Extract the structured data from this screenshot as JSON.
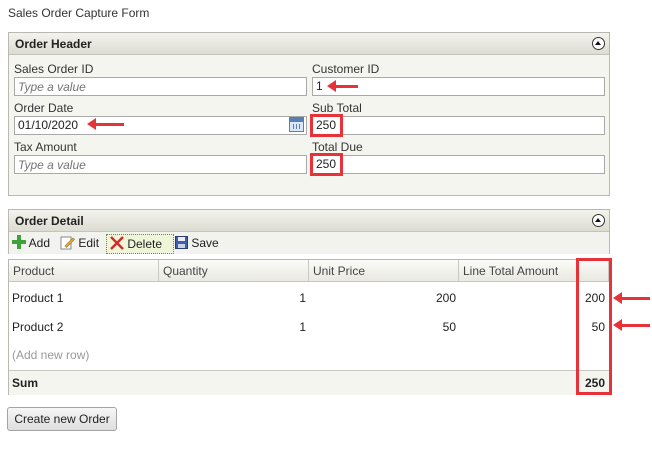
{
  "form_title": "Sales Order Capture Form",
  "order_header": {
    "title": "Order Header",
    "sales_order_id": {
      "label": "Sales Order ID",
      "placeholder": "Type a value"
    },
    "customer_id": {
      "label": "Customer ID",
      "value": "1"
    },
    "order_date": {
      "label": "Order Date",
      "value": "01/10/2020"
    },
    "sub_total": {
      "label": "Sub Total",
      "value": "250"
    },
    "tax_amount": {
      "label": "Tax Amount",
      "placeholder": "Type a value"
    },
    "total_due": {
      "label": "Total Due",
      "value": "250"
    }
  },
  "order_detail": {
    "title": "Order Detail",
    "toolbar": {
      "add": "Add",
      "edit": "Edit",
      "delete": "Delete",
      "save": "Save"
    },
    "columns": [
      "Product",
      "Quantity",
      "Unit Price",
      "Line Total Amount"
    ],
    "rows": [
      {
        "product": "Product 1",
        "quantity": "1",
        "unit_price": "200",
        "line_total": "200"
      },
      {
        "product": "Product 2",
        "quantity": "1",
        "unit_price": "50",
        "line_total": "50"
      }
    ],
    "add_row": "(Add new row)",
    "sum_label": "Sum",
    "sum_value": "250"
  },
  "create_button": "Create new Order",
  "colors": {
    "annotation": "#e8323a",
    "panel_border": "#b9b9b1"
  },
  "icons": [
    "collapse-icon",
    "calendar-icon",
    "plus-icon",
    "edit-icon",
    "delete-x-icon",
    "save-disk-icon"
  ]
}
